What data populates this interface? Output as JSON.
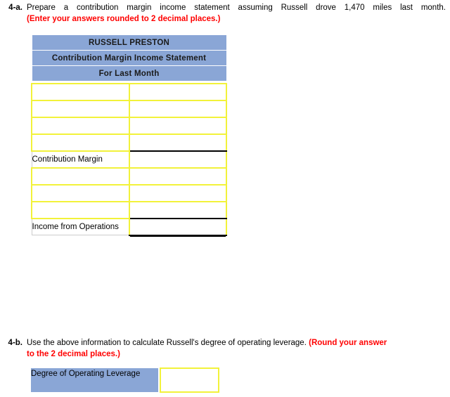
{
  "questions": {
    "a": {
      "number": "4-a.",
      "prompt": "Prepare a contribution margin income statement assuming Russell drove 1,470 miles last month.",
      "instruction": "(Enter your answers rounded to 2 decimal places.)"
    },
    "b": {
      "number": "4-b.",
      "prompt": "Use the above information to calculate Russell's degree of operating leverage.",
      "instruction_part1": "(Round your answer",
      "instruction_part2": "to the 2 decimal places.)"
    }
  },
  "statement": {
    "headers": [
      "RUSSELL PRESTON",
      "Contribution Margin Income Statement",
      "For Last Month"
    ],
    "rows": [
      {
        "label": "",
        "label_type": "input",
        "value": "",
        "rule": "none"
      },
      {
        "label": "",
        "label_type": "input",
        "value": "",
        "rule": "none"
      },
      {
        "label": "",
        "label_type": "input",
        "value": "",
        "rule": "none"
      },
      {
        "label": "",
        "label_type": "input",
        "value": "",
        "rule": "bottom"
      },
      {
        "label": "Contribution Margin",
        "label_type": "text",
        "value": "",
        "rule": "none"
      },
      {
        "label": "",
        "label_type": "input",
        "value": "",
        "rule": "none"
      },
      {
        "label": "",
        "label_type": "input",
        "value": "",
        "rule": "none"
      },
      {
        "label": "",
        "label_type": "input",
        "value": "",
        "rule": "bottom"
      },
      {
        "label": "Income from Operations",
        "label_type": "text",
        "value": "",
        "rule": "double"
      }
    ]
  },
  "dol": {
    "label": "Degree of Operating Leverage",
    "value": ""
  },
  "colors": {
    "header_blue": "#8aa6d6",
    "input_yellow": "#f2f23a",
    "instruction_red": "#ff0000",
    "rule_black": "#000000"
  }
}
